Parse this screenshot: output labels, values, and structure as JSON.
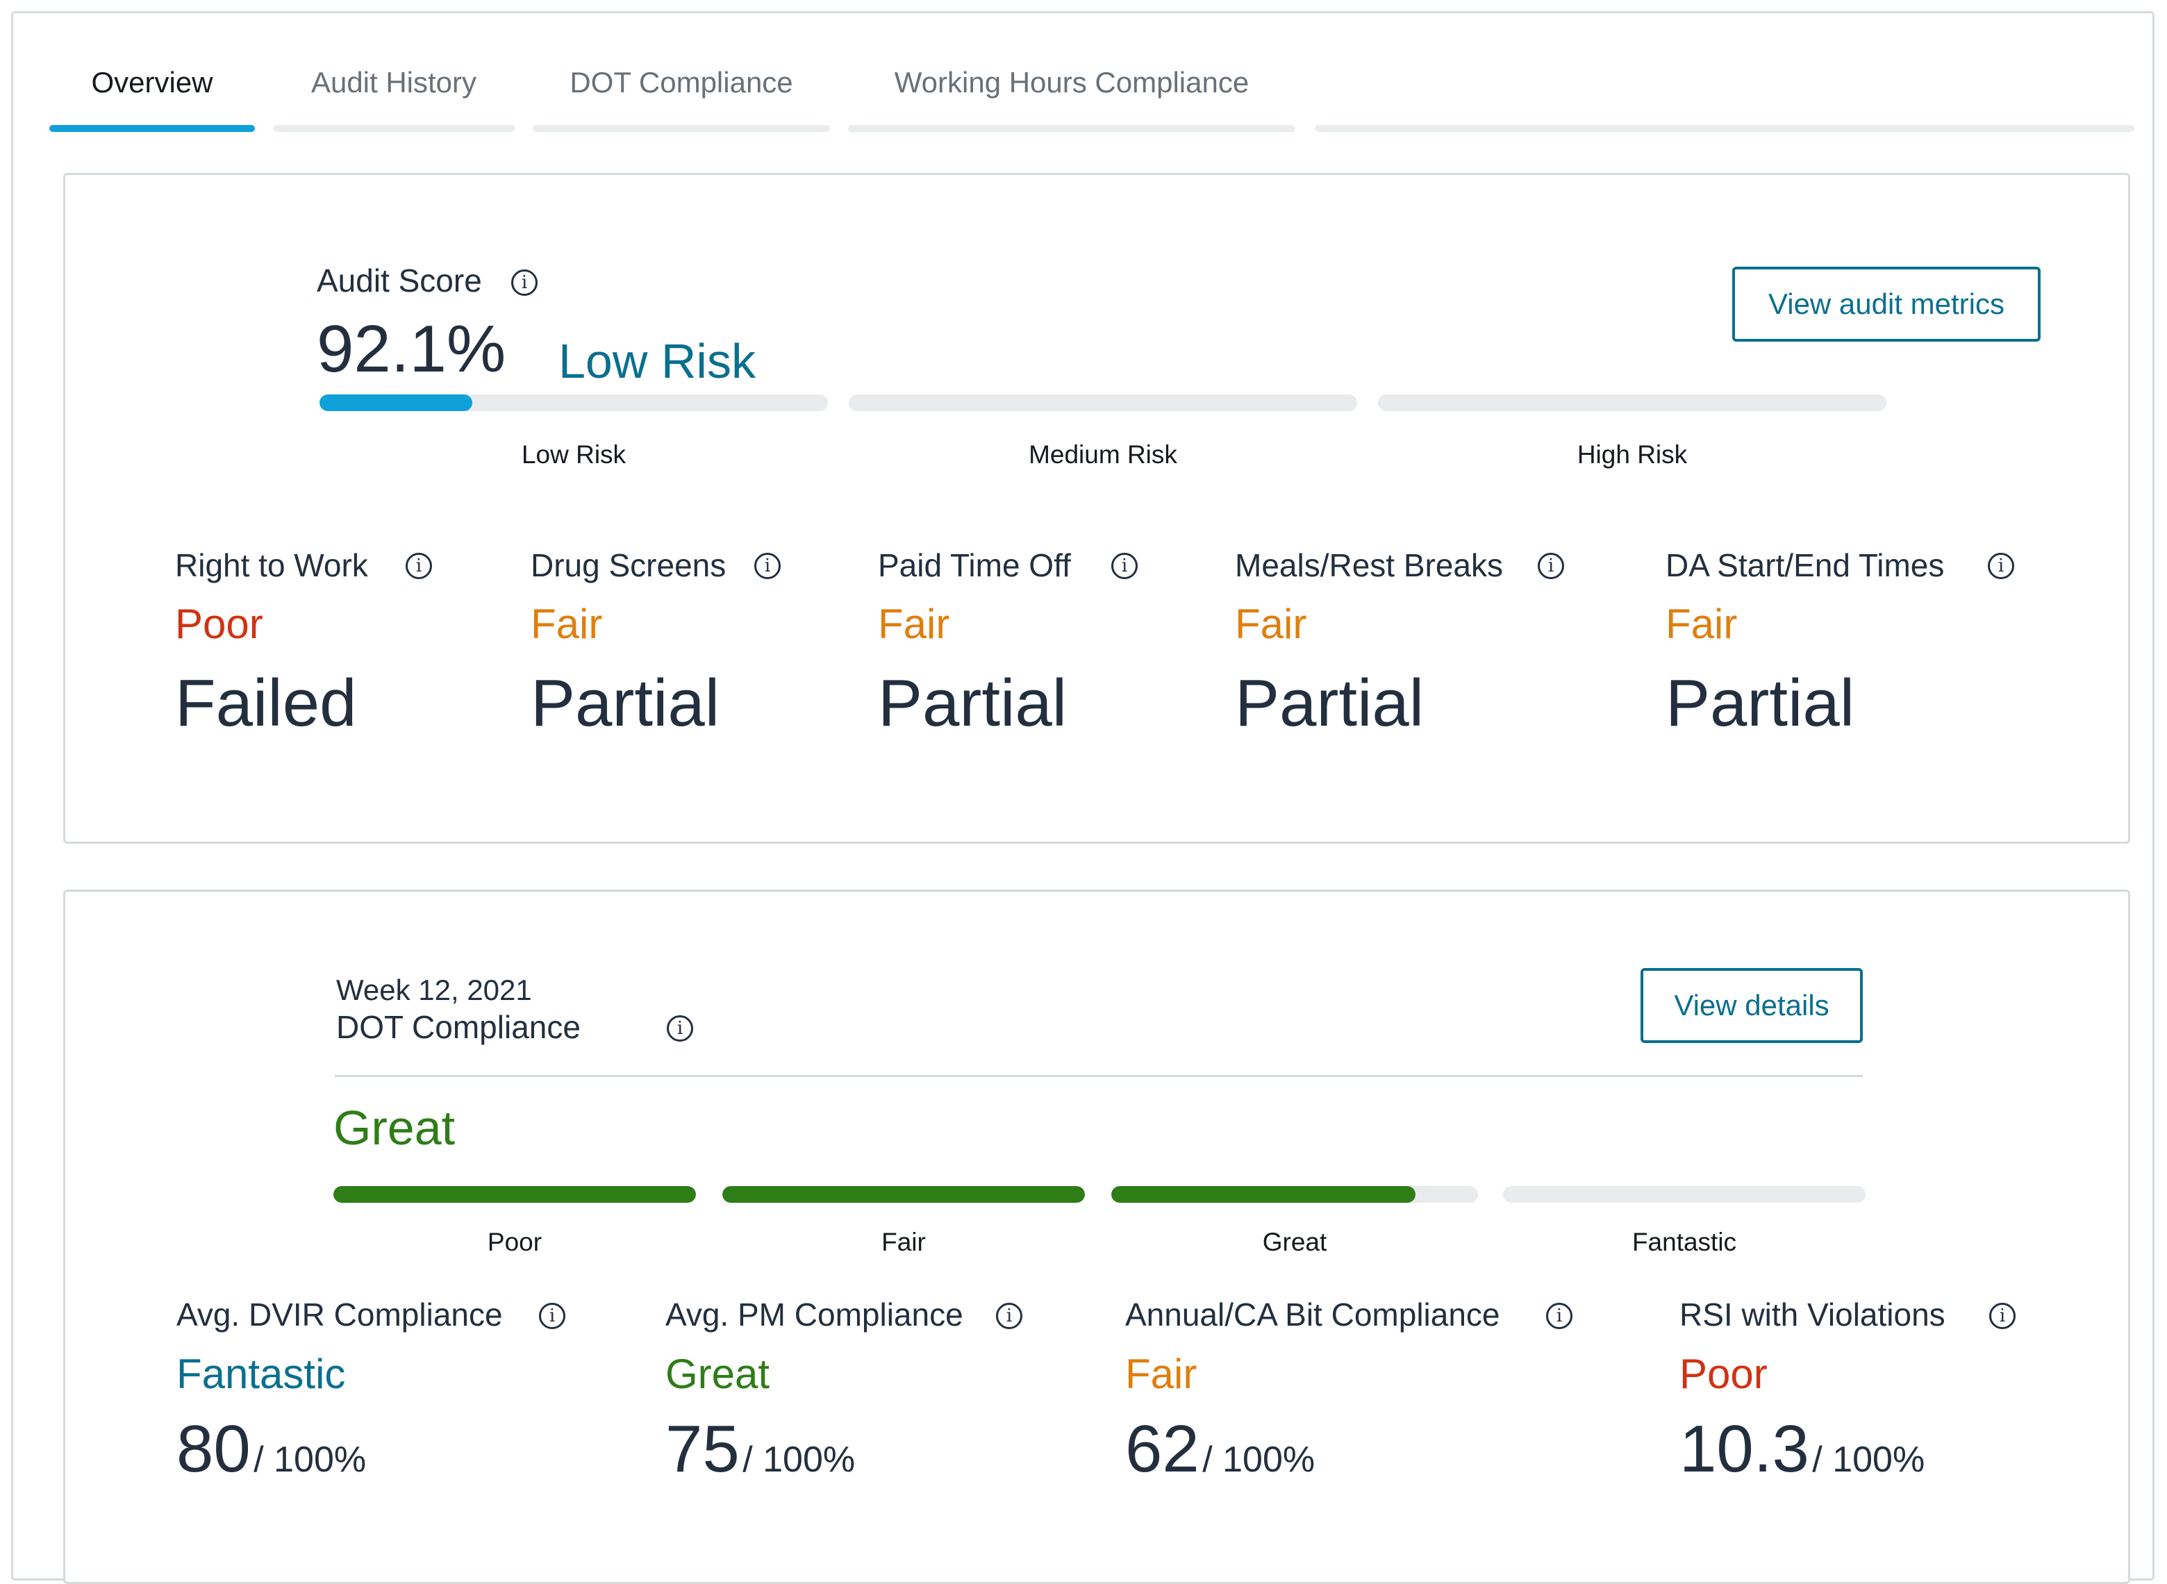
{
  "tabs": [
    {
      "label": "Overview",
      "active": true
    },
    {
      "label": "Audit History",
      "active": false
    },
    {
      "label": "DOT Compliance",
      "active": false
    },
    {
      "label": "Working Hours Compliance",
      "active": false
    }
  ],
  "audit": {
    "title": "Audit Score",
    "score": "92.1%",
    "risk_label": "Low Risk",
    "view_button": "View audit metrics",
    "risk_scale": [
      {
        "label": "Low Risk",
        "fill_fraction": 0.3
      },
      {
        "label": "Medium Risk",
        "fill_fraction": 0
      },
      {
        "label": "High Risk",
        "fill_fraction": 0
      }
    ],
    "metrics": [
      {
        "title": "Right to Work",
        "rating": "Poor",
        "status": "Failed"
      },
      {
        "title": "Drug Screens",
        "rating": "Fair",
        "status": "Partial"
      },
      {
        "title": "Paid Time Off",
        "rating": "Fair",
        "status": "Partial"
      },
      {
        "title": "Meals/Rest Breaks",
        "rating": "Fair",
        "status": "Partial"
      },
      {
        "title": "DA Start/End Times",
        "rating": "Fair",
        "status": "Partial"
      }
    ]
  },
  "dot": {
    "week": "Week 12, 2021",
    "title": "DOT Compliance",
    "view_button": "View details",
    "rating": "Great",
    "scale": [
      {
        "label": "Poor",
        "fill_fraction": 1
      },
      {
        "label": "Fair",
        "fill_fraction": 1
      },
      {
        "label": "Great",
        "fill_fraction": 0.83
      },
      {
        "label": "Fantastic",
        "fill_fraction": 0
      }
    ],
    "metrics": [
      {
        "title": "Avg. DVIR Compliance",
        "rating": "Fantastic",
        "value": "80",
        "denom": "/ 100%"
      },
      {
        "title": "Avg. PM Compliance",
        "rating": "Great",
        "value": "75",
        "denom": "/ 100%"
      },
      {
        "title": "Annual/CA Bit Compliance",
        "rating": "Fair",
        "value": "62",
        "denom": "/ 100%"
      },
      {
        "title": "RSI with Violations",
        "rating": "Poor",
        "value": "10.3",
        "denom": "/ 100%"
      }
    ]
  },
  "colors": {
    "poor": "#d13212",
    "fair": "#df7f0f",
    "great": "#2e7d17",
    "fantastic": "#0a6f8f",
    "risk_low": "#0fa0d9",
    "tab_active": "#0fa0d9"
  }
}
